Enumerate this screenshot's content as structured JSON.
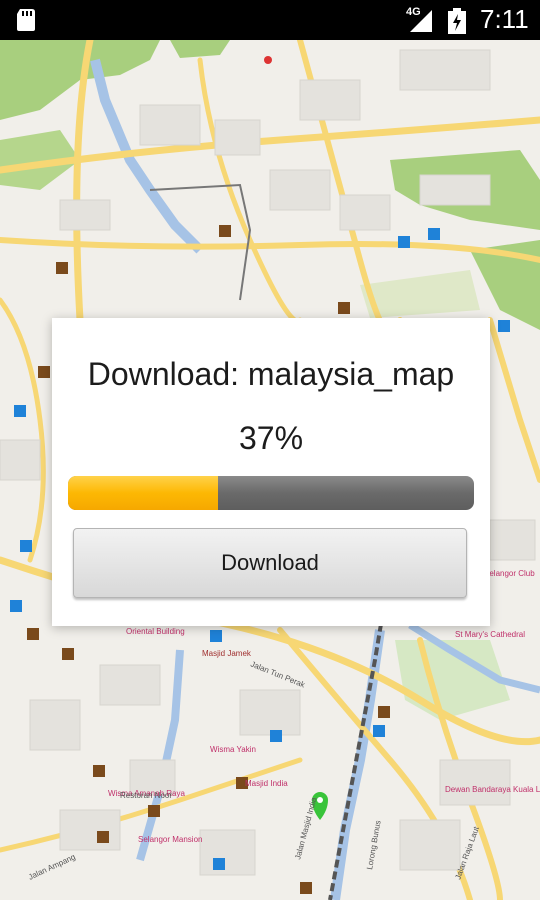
{
  "status_bar": {
    "network": "4G",
    "time": "7:11"
  },
  "map": {
    "labels": [
      "Oriental Building",
      "St Mary's Cathedral",
      "Jalan Tun Perak",
      "Wisma Amanah Raya",
      "Masjid India",
      "Restoran Noor",
      "Selangor Mansion",
      "Dewan Bandaraya Kuala Lumpur",
      "Selangor Club",
      "Masjid Jamek",
      "Wisma Yakin",
      "Jalan Ampang",
      "Lorong Bunus",
      "Jalan Raja Laut",
      "Jalan Masjid India"
    ]
  },
  "dialog": {
    "title": "Download: malaysia_map",
    "percent_text": "37%",
    "progress": 0.37,
    "button_label": "Download"
  },
  "colors": {
    "progress_fill": "#fdb803",
    "progress_track": "#6a6a6a",
    "road_major": "#f7d774",
    "park": "#a8cf7e",
    "river": "#a6c3e6"
  }
}
